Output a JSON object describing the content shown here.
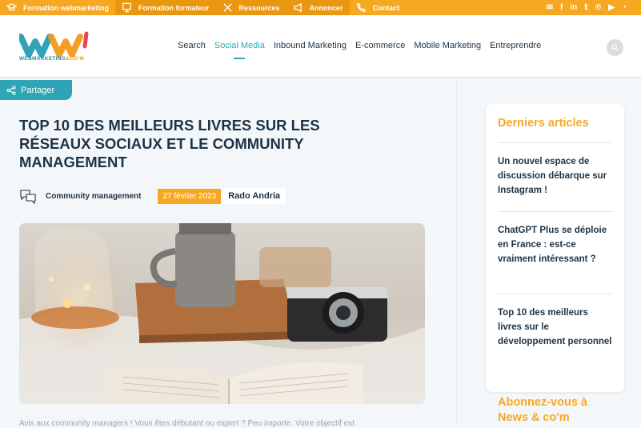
{
  "topbar": {
    "links": [
      {
        "label": "Formation webmarketing",
        "icon": "graduation-cap-icon"
      },
      {
        "label": "Formation formateur",
        "icon": "presentation-board-icon"
      },
      {
        "label": "Ressources",
        "icon": "tools-icon"
      },
      {
        "label": "Annoncer",
        "icon": "megaphone-icon"
      },
      {
        "label": "Contact",
        "icon": "phone-icon"
      }
    ],
    "social": [
      "newsletter-icon",
      "facebook-icon",
      "linkedin-icon",
      "twitter-icon",
      "pinterest-icon",
      "youtube-icon",
      "rss-icon"
    ]
  },
  "header": {
    "logo_text_main": "WEBMARKETING",
    "logo_text_accent": "&CO'M",
    "nav": [
      {
        "label": "Search",
        "active": false
      },
      {
        "label": "Social Media",
        "active": true
      },
      {
        "label": "Inbound Marketing",
        "active": false
      },
      {
        "label": "E-commerce",
        "active": false
      },
      {
        "label": "Mobile Marketing",
        "active": false
      },
      {
        "label": "Entreprendre",
        "active": false
      }
    ]
  },
  "share": {
    "label": "Partager"
  },
  "article": {
    "title": "TOP 10 DES MEILLEURS LIVRES SUR LES RÉSEAUX SOCIAUX ET LE COMMUNITY MANAGEMENT",
    "category": "Community management",
    "date": "27 février 2023",
    "author": "Rado Andria",
    "lede": "Avis aux community managers ! Vous êtes débutant ou expert ? Peu importe. Votre objectif est"
  },
  "sidebar": {
    "title": "Derniers articles",
    "articles": [
      "Un nouvel espace de discussion débarque sur Instagram !",
      "ChatGPT Plus se déploie en France : est-ce vraiment intéressant ?",
      "Top 10 des meilleurs livres sur le développement personnel"
    ],
    "subscribe": "Abonnez-vous à News & co'm"
  },
  "colors": {
    "accent": "#f7a823",
    "teal": "#2fa4b6",
    "navy": "#1d3345"
  }
}
